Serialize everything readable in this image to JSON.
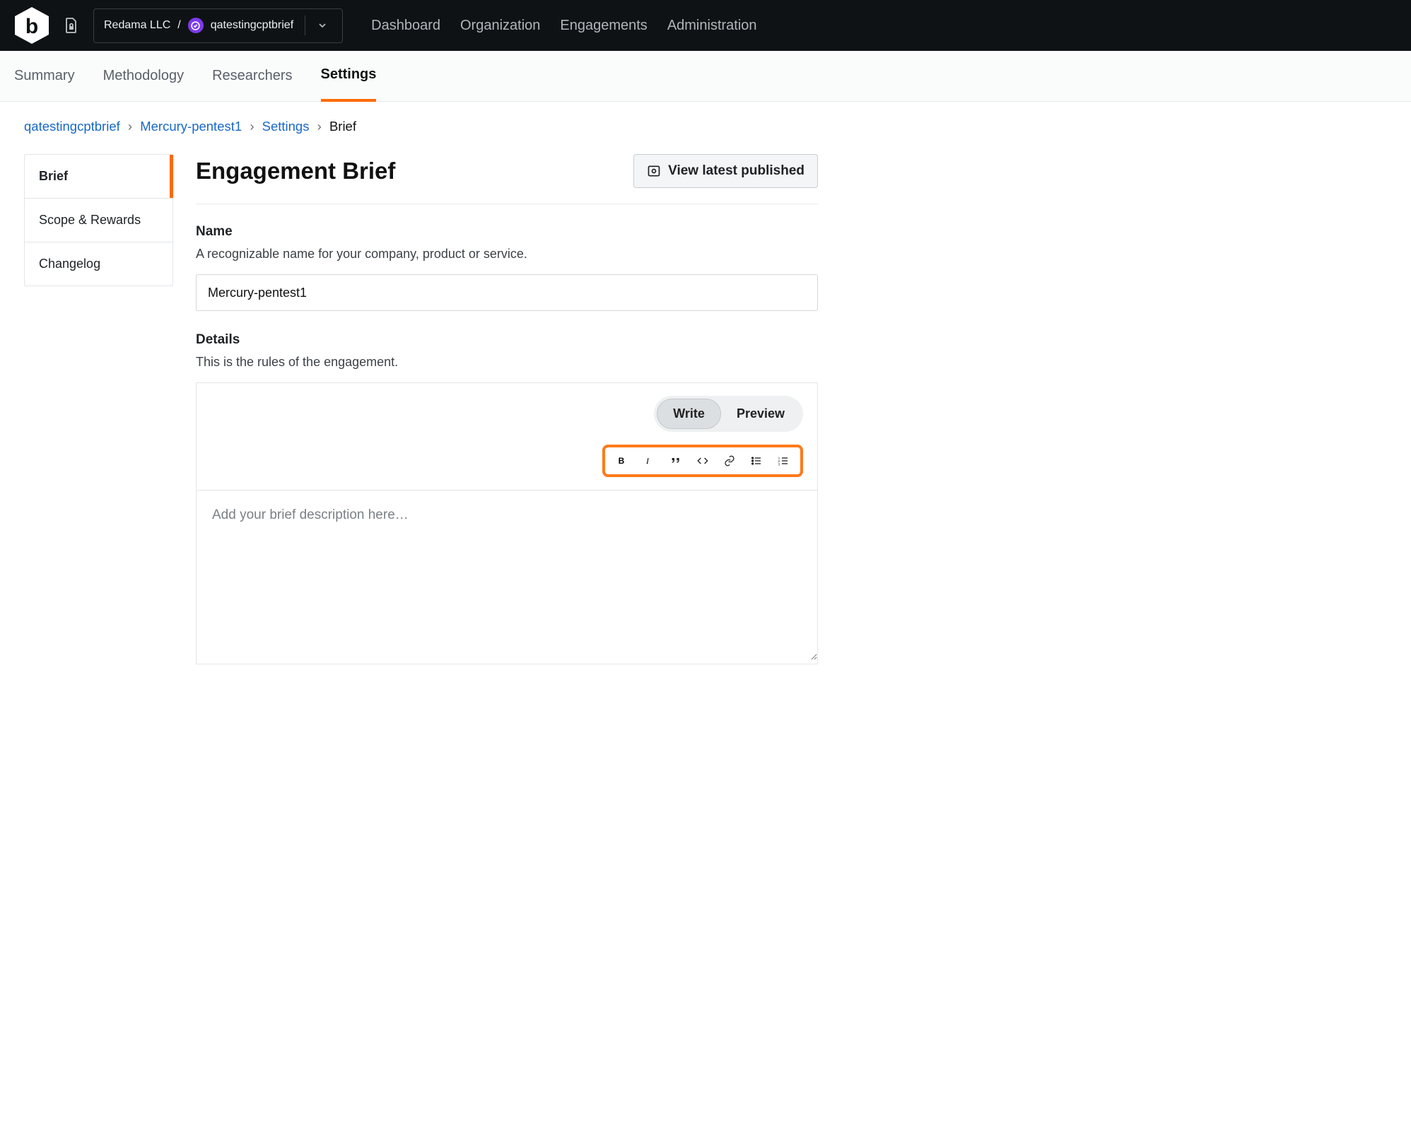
{
  "topbar": {
    "org_name": "Redama LLC",
    "separator": "/",
    "project_name": "qatestingcptbrief",
    "nav": [
      "Dashboard",
      "Organization",
      "Engagements",
      "Administration"
    ]
  },
  "subnav": {
    "items": [
      "Summary",
      "Methodology",
      "Researchers",
      "Settings"
    ],
    "active_index": 3
  },
  "breadcrumbs": {
    "items": [
      {
        "label": "qatestingcptbrief",
        "link": true
      },
      {
        "label": "Mercury-pentest1",
        "link": true
      },
      {
        "label": "Settings",
        "link": true
      },
      {
        "label": "Brief",
        "link": false
      }
    ],
    "sep": "›"
  },
  "sidebar": {
    "items": [
      "Brief",
      "Scope & Rewards",
      "Changelog"
    ],
    "active_index": 0
  },
  "page": {
    "title": "Engagement Brief",
    "view_published": "View latest published"
  },
  "name_field": {
    "label": "Name",
    "help": "A recognizable name for your company, product or service.",
    "value": "Mercury-pentest1"
  },
  "details_field": {
    "label": "Details",
    "help": "This is the rules of the engagement.",
    "write": "Write",
    "preview": "Preview",
    "placeholder": "Add your brief description here…",
    "toolbar": [
      "bold",
      "italic",
      "quote",
      "code",
      "link",
      "ul",
      "ol"
    ]
  },
  "colors": {
    "accent": "#ff6a00",
    "link": "#1868c7",
    "badge": "#7c3aed"
  }
}
